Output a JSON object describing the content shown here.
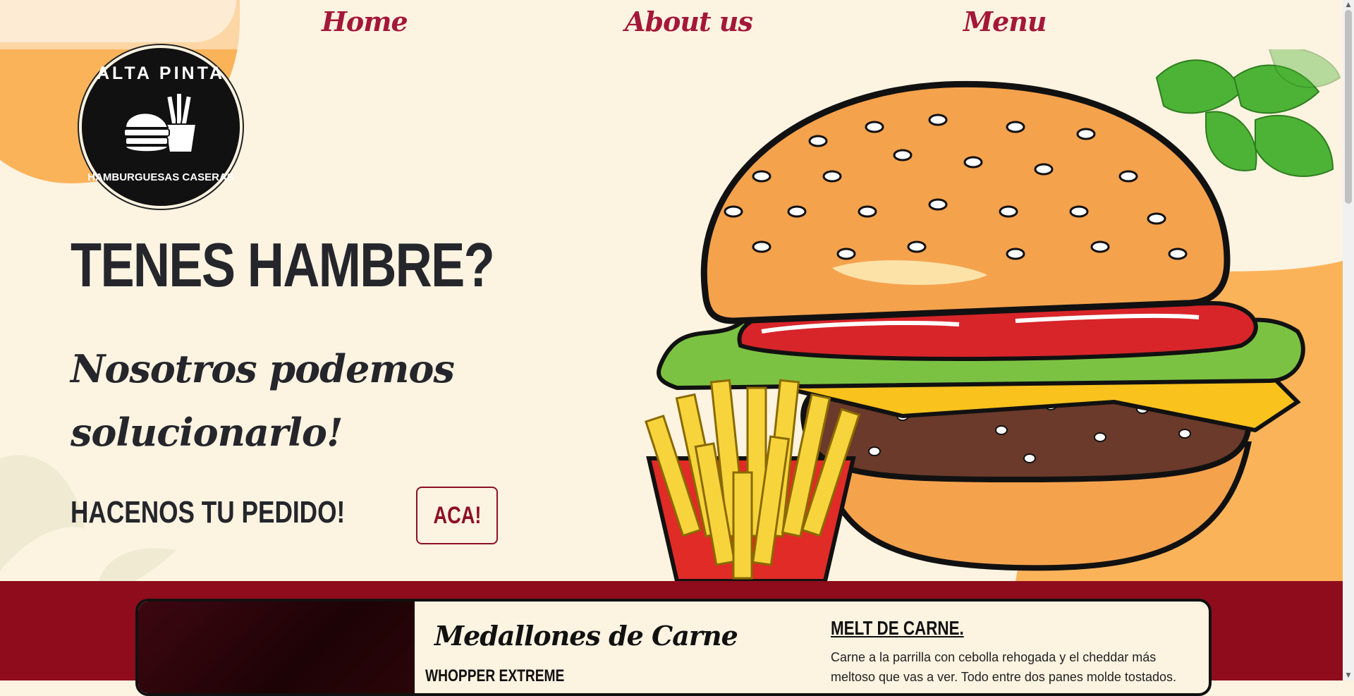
{
  "nav": {
    "items": [
      {
        "label": "Home"
      },
      {
        "label": "About us"
      },
      {
        "label": "Menu"
      }
    ]
  },
  "logo": {
    "top_text": "ALTA PINTA",
    "bottom_text": "HAMBURGUESAS CASERAS"
  },
  "hero": {
    "headline": "TENES HAMBRE?",
    "subheadline": "Nosotros podemos solucionarlo!",
    "order_text": "HACENOS TU PEDIDO!",
    "cta_label": "ACA!"
  },
  "menu_card": {
    "title": "Medallones de Carne",
    "subtitle": "WHOPPER EXTREME",
    "item_name": "MELT DE CARNE.",
    "item_description": "Carne a la parrilla con cebolla rehogada y el cheddar más meltoso que vas a ver. Todo entre dos panes molde tostados."
  },
  "colors": {
    "background": "#fdf3e1",
    "accent": "#a3183a",
    "menu_band": "#8e0c1c",
    "text": "#24262b",
    "orange_blob": "#fbb35a"
  },
  "icons": [
    "burger-fries-logo-icon",
    "burger-illustration",
    "fries-illustration",
    "parsley-leaf-illustration"
  ]
}
